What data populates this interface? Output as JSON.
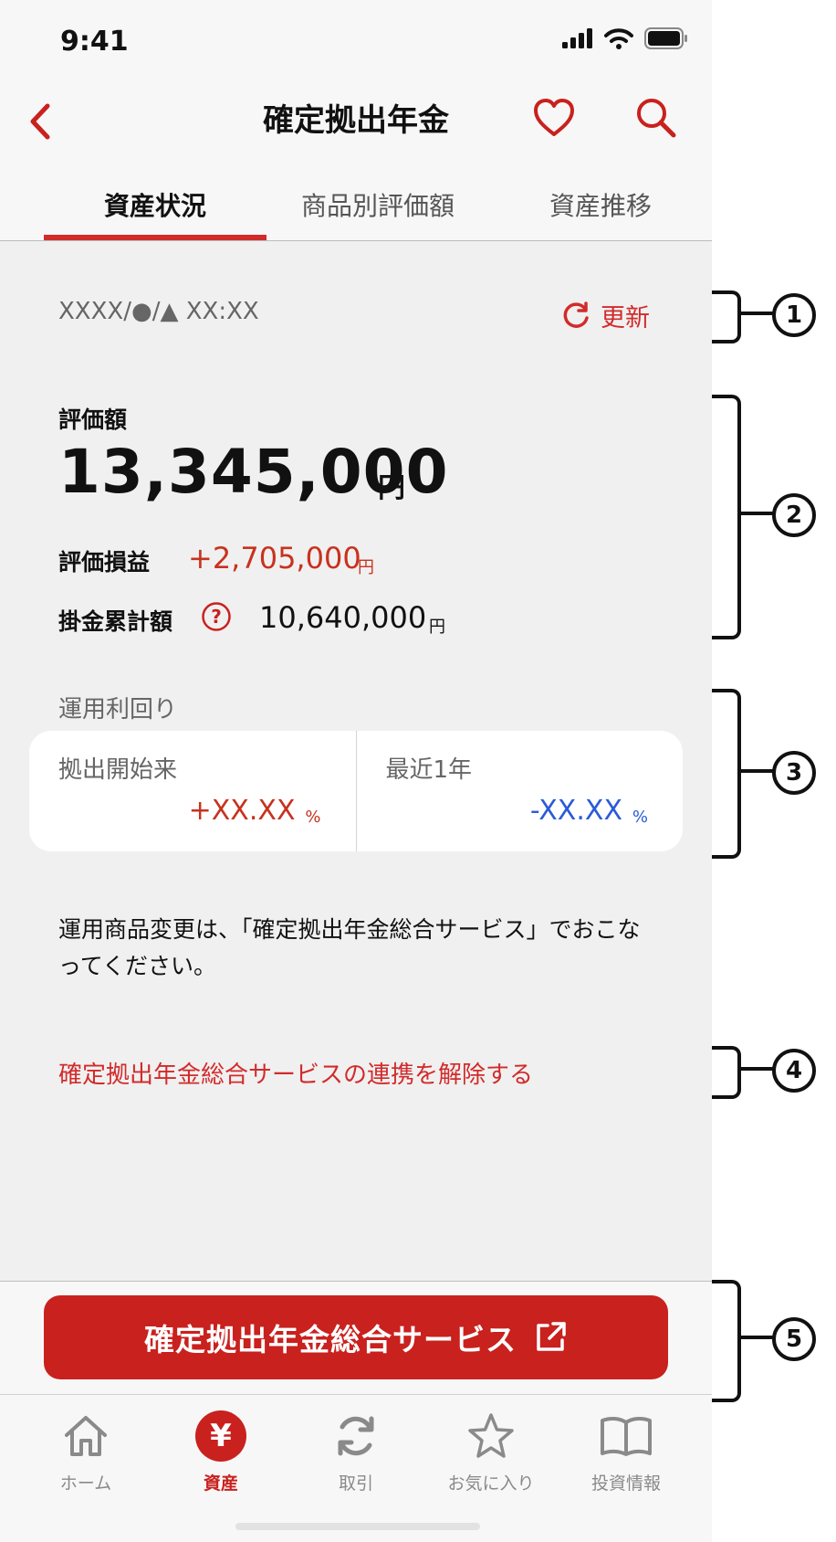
{
  "status_bar": {
    "time": "9:41"
  },
  "header": {
    "title": "確定拠出年金"
  },
  "tabs": [
    {
      "label": "資産状況",
      "active": true
    },
    {
      "label": "商品別評価額",
      "active": false
    },
    {
      "label": "資産推移",
      "active": false
    }
  ],
  "summary": {
    "timestamp": "XXXX/●/▲ XX:XX",
    "refresh_label": "更新",
    "eval_label": "評価額",
    "eval_value": "13,345,000",
    "eval_unit": "円",
    "pl_label": "評価損益",
    "pl_value": "+2,705,000",
    "pl_unit": "円",
    "contrib_label": "掛金累計額",
    "contrib_value": "10,640,000",
    "contrib_unit": "円"
  },
  "yield": {
    "title": "運用利回り",
    "since_start_label": "拠出開始来",
    "since_start_value": "+XX.XX",
    "recent_label": "最近1年",
    "recent_value": "-XX.XX",
    "unit": "%"
  },
  "notice": "運用商品変更は、「確定拠出年金総合サービス」でおこなってください。",
  "unlink_label": "確定拠出年金総合サービスの連携を解除する",
  "cta_label": "確定拠出年金総合サービス",
  "bottom_nav": [
    {
      "label": "ホーム",
      "icon": "home-icon"
    },
    {
      "label": "資産",
      "icon": "yen-icon",
      "active": true
    },
    {
      "label": "取引",
      "icon": "refresh-icon"
    },
    {
      "label": "お気に入り",
      "icon": "star-icon"
    },
    {
      "label": "投資情報",
      "icon": "book-icon"
    }
  ],
  "annotations": [
    "1",
    "2",
    "3",
    "4",
    "5"
  ],
  "colors": {
    "accent": "#c9211e",
    "positive": "#c8321e",
    "negative": "#2a5bd7"
  }
}
